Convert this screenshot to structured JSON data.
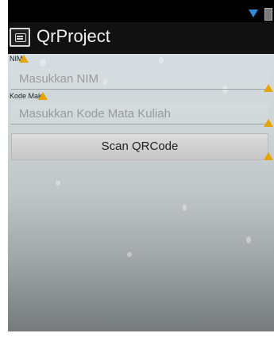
{
  "app": {
    "title": "QrProject",
    "icon": "chat-bubble-icon"
  },
  "status_bar": {
    "icons": [
      "wifi-icon",
      "battery-icon"
    ],
    "wifi_color": "#2f8bd8"
  },
  "form": {
    "nim": {
      "label": "NIM",
      "placeholder": "Masukkan NIM"
    },
    "kode_mk": {
      "label": "Kode Mak",
      "placeholder": "Masukkan Kode Mata Kuliah"
    },
    "scan_button": "Scan QRCode"
  },
  "warning_color": "#e6a400"
}
